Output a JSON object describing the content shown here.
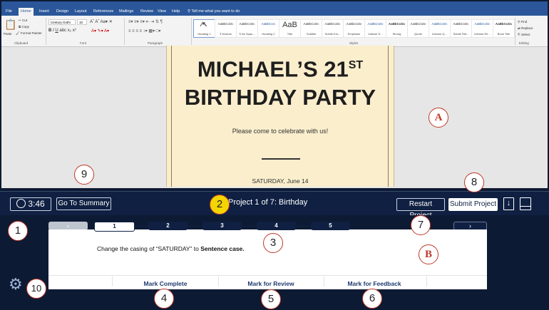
{
  "word": {
    "tabs": [
      "File",
      "Home",
      "Insert",
      "Design",
      "Layout",
      "References",
      "Mailings",
      "Review",
      "View",
      "Help"
    ],
    "tell_me": "Tell me what you want to do",
    "clipboard": {
      "paste": "Paste",
      "cut": "Cut",
      "copy": "Copy",
      "format_painter": "Format Painter",
      "group": "Clipboard"
    },
    "font": {
      "name": "Century Gothi",
      "size": "10",
      "group": "Font"
    },
    "paragraph_group": "Paragraph",
    "styles_group": "Styles",
    "styles": [
      {
        "sample": "AaBbCcDc",
        "label": "Heading 1"
      },
      {
        "sample": "AaBbCcDc",
        "label": "¶ Normal"
      },
      {
        "sample": "AaBbCcDc",
        "label": "¶ No Spac..."
      },
      {
        "sample": "AaBbCcC",
        "label": "Heading 2"
      },
      {
        "sample": "AaB",
        "label": "Title"
      },
      {
        "sample": "AaBbCcDc",
        "label": "Subtitle"
      },
      {
        "sample": "AaBbCcDc",
        "label": "Subtle Em..."
      },
      {
        "sample": "AaBbCcDc",
        "label": "Emphasis"
      },
      {
        "sample": "AaBbCcDc",
        "label": "Intense E..."
      },
      {
        "sample": "AaBbCcDc",
        "label": "Strong"
      },
      {
        "sample": "AaBbCcDc",
        "label": "Quote"
      },
      {
        "sample": "AaBbCcDc",
        "label": "Intense Q..."
      },
      {
        "sample": "AaBbCcDc",
        "label": "Subtle Ref..."
      },
      {
        "sample": "AaBbCcDc",
        "label": "Intense Re..."
      },
      {
        "sample": "AaBbCcDc",
        "label": "Book Title"
      }
    ],
    "editing": {
      "find": "Find",
      "replace": "Replace",
      "select": "Select",
      "group": "Editing"
    }
  },
  "document": {
    "title_line1": "MICHAEL’S 21",
    "title_sup": "ST",
    "title_line2": "BIRTHDAY PARTY",
    "subtitle": "Please come to celebrate with us!",
    "date": "SATURDAY, June 14"
  },
  "exam": {
    "timer": "3:46",
    "go_to_summary": "Go To Summary",
    "project_title": "Project 1 of 7: Birthday",
    "restart": "Restart Project",
    "submit": "Submit Project",
    "steps": [
      "1",
      "2",
      "3",
      "4",
      "5"
    ],
    "current_step": "1",
    "instruction_prefix": "Change the casing of “SATURDAY” to ",
    "instruction_bold": "Sentence case.",
    "actions": {
      "mark_complete": "Mark Complete",
      "mark_review": "Mark for Review",
      "mark_feedback": "Mark for Feedback"
    }
  },
  "callouts": {
    "a": "A",
    "b": "B",
    "n1": "1",
    "n2": "2",
    "n3": "3",
    "n4": "4",
    "n5": "5",
    "n6": "6",
    "n7": "7",
    "n8": "8",
    "n9": "9",
    "n10": "10"
  },
  "colors": {
    "word_blue": "#2b579a",
    "exam_navy": "#0f2042",
    "page_cream": "#fbeecd",
    "callout_red": "#c0392b",
    "callout_yellow": "#f4d500"
  }
}
